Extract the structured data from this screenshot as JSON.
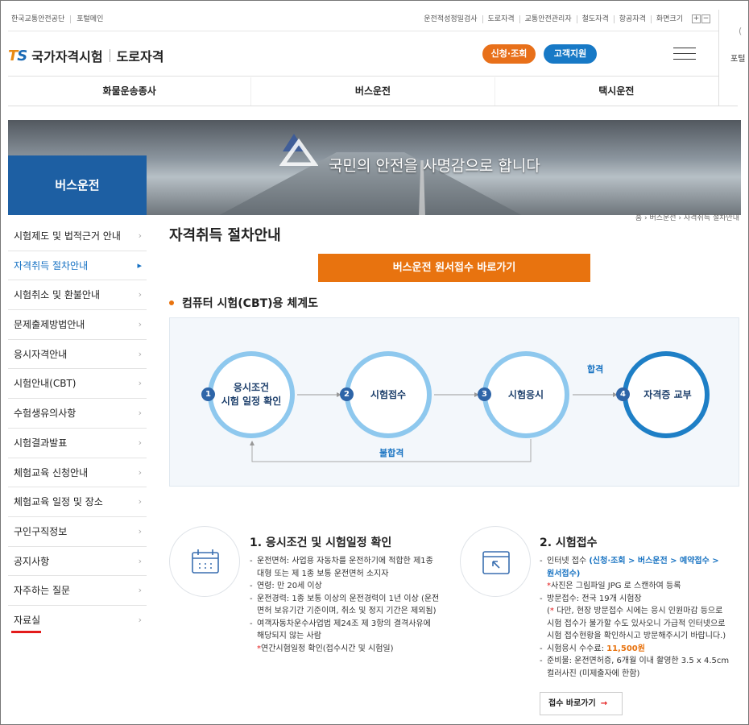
{
  "util": {
    "left": [
      "한국교통안전공단",
      "포털메인"
    ],
    "right": [
      "운전적성정밀검사",
      "도로자격",
      "교통안전관리자",
      "철도자격",
      "항공자격"
    ],
    "zoom_label": "화면크기",
    "zoom_in": "+",
    "zoom_out": "−"
  },
  "sidestrip": {
    "text": "포털"
  },
  "header": {
    "logo_t": "T",
    "logo_s": "S",
    "logo_name": "국가자격시험",
    "logo_sub": "도로자격",
    "apply_btn": "신청·조회",
    "support_btn": "고객지원"
  },
  "gnb": [
    "화물운송종사",
    "버스운전",
    "택시운전"
  ],
  "banner": {
    "slogan": "국민의 안전을 사명감으로 합니다"
  },
  "lnb": {
    "title": "버스운전",
    "items": [
      "시험제도 및 법적근거 안내",
      "자격취득 절차안내",
      "시험취소 및 환불안내",
      "문제출제방법안내",
      "응시자격안내",
      "시험안내(CBT)",
      "수험생유의사항",
      "시험결과발표",
      "체험교육 신청안내",
      "체험교육 일정 및 장소",
      "구인구직정보",
      "공지사항",
      "자주하는 질문",
      "자료실"
    ],
    "active_index": 1
  },
  "breadcrumb": "홈 › 버스운전 › 자격취득 절차안내",
  "page_title": "자격취득 절차안내",
  "main_button": "버스운전 원서접수 바로가기",
  "section_title": "컴퓨터 시험(CBT)용 체계도",
  "flow": {
    "steps": [
      {
        "num": "1",
        "label1": "응시조건",
        "label2": "시험 일정 확인"
      },
      {
        "num": "2",
        "label1": "시험접수",
        "label2": ""
      },
      {
        "num": "3",
        "label1": "시험응시",
        "label2": ""
      },
      {
        "num": "4",
        "label1": "자격증 교부",
        "label2": ""
      }
    ],
    "pass": "합격",
    "fail": "불합격"
  },
  "step1": {
    "title": "1. 응시조건 및 시험일정 확인",
    "items": [
      [
        "운전면허: 사업용 자동차를 운전하기에 적합한 제1종",
        "대형 또는 제 1종 보통 운전면허 소지자"
      ],
      [
        "연령: 만 20세 이상"
      ],
      [
        "운전경력: 1종 보통 이상의 운전경력이 1년 이상 (운전",
        "면허 보유기간 기준이며, 취소 및 정지 기간은 제외됨)"
      ],
      [
        "여객자동차운수사업법 제24조 제 3항의 결격사유에",
        "해당되지 않는 사람"
      ]
    ],
    "note_star": "*",
    "note": "연간시험일정 확인(접수시간 및 시험일)"
  },
  "step2": {
    "title": "2. 시험접수",
    "internet_label": "인터넷 접수 ",
    "internet_path1": "(신청·조회 > 버스운전 > 예약접수 >",
    "internet_path2": "원서접수)",
    "photo_note_star": "*",
    "photo_note": "사진은 그림파일 JPG 로 스캔하여 등록",
    "visit": "방문접수: 전국 19개 시험장",
    "visit_note_open": "(",
    "visit_note_star": "*",
    "visit_note1": " 다만, 현장 방문접수 시에는 응시 인원마감 등으로",
    "visit_note2": "시험 접수가 불가할 수도 있사오니 가급적 인터넷으로",
    "visit_note3": "시험 접수현황을 확인하시고 방문해주시기 바랍니다.)",
    "fee_label": "시험응시 수수료: ",
    "fee_value": "11,500원",
    "prep1": "준비물: 운전면허증, 6개월 이내 촬영한 3.5 x 4.5cm",
    "prep2": "컬러사진 (미제출자에 한함)",
    "go_btn": "접수 바로가기",
    "go_arrow": "→"
  }
}
